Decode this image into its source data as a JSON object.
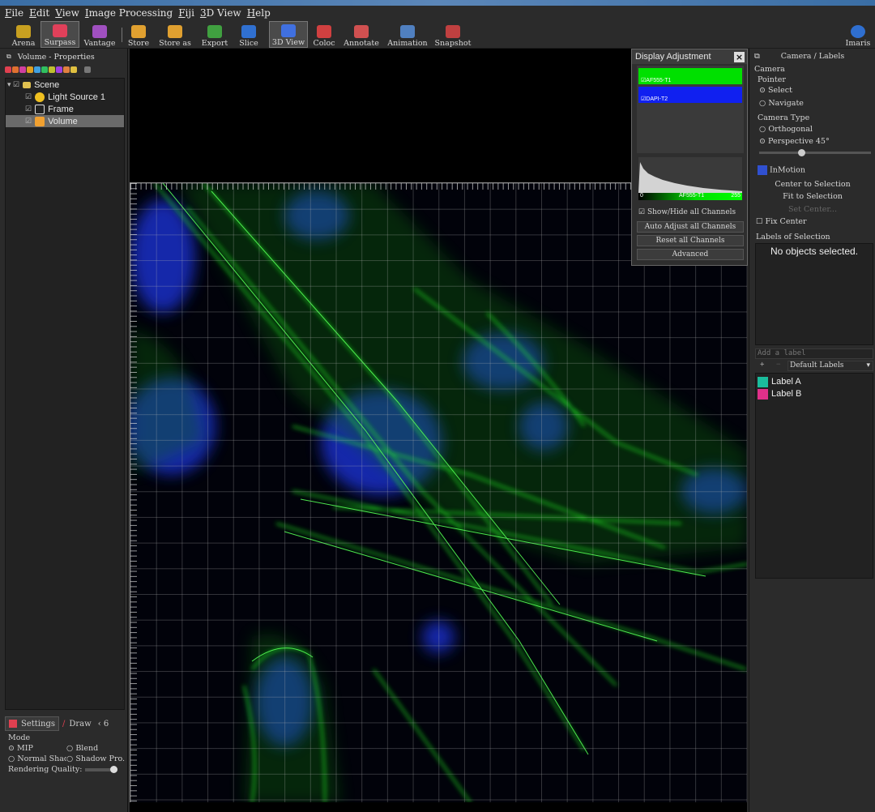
{
  "menu": [
    "File",
    "Edit",
    "View",
    "Image Processing",
    "Fiji",
    "3D View",
    "Help"
  ],
  "toolbar": {
    "buttons": [
      {
        "label": "Arena",
        "icon": "arena-icon",
        "color": "#c8a020"
      },
      {
        "label": "Surpass",
        "icon": "surpass-icon",
        "color": "#e0405a",
        "active": true
      },
      {
        "label": "Vantage",
        "icon": "vantage-icon",
        "color": "#a050c0"
      },
      {
        "label": "Store",
        "icon": "store-icon",
        "color": "#e0a030"
      },
      {
        "label": "Store as",
        "icon": "store-as-icon",
        "color": "#e0a030"
      },
      {
        "label": "Export",
        "icon": "export-icon",
        "color": "#40a040"
      },
      {
        "label": "Slice",
        "icon": "slice-icon",
        "color": "#3070d0"
      },
      {
        "label": "3D View",
        "icon": "3d-view-icon",
        "color": "#4070e0",
        "active": true
      },
      {
        "label": "Coloc",
        "icon": "coloc-icon",
        "color": "#d04040"
      },
      {
        "label": "Annotate",
        "icon": "annotate-icon",
        "color": "#d05050"
      },
      {
        "label": "Animation",
        "icon": "animation-icon",
        "color": "#5080c0"
      },
      {
        "label": "Snapshot",
        "icon": "snapshot-icon",
        "color": "#c04040"
      }
    ],
    "brand": "Imaris"
  },
  "left": {
    "header": "Volume - Properties",
    "tree": [
      {
        "label": "Scene",
        "icon": "folder-icon"
      },
      {
        "label": "Light Source 1",
        "icon": "light-source-icon"
      },
      {
        "label": "Frame",
        "icon": "frame-icon"
      },
      {
        "label": "Volume",
        "icon": "volume-icon",
        "selected": true
      }
    ],
    "tabs": [
      "Settings",
      "Draw"
    ],
    "settings": {
      "mode_label": "Mode",
      "options": [
        "MIP",
        "Blend",
        "Normal Shac",
        "Shadow Pro."
      ],
      "selected": "MIP",
      "quality_label": "Rendering Quality:"
    }
  },
  "display_adjustment": {
    "title": "Display Adjustment",
    "channels": [
      {
        "name": "AF555-T1",
        "color": "#00e000"
      },
      {
        "name": "DAPI-T2",
        "color": "#1020f0"
      }
    ],
    "range_min": "0",
    "range_max": "255",
    "active_channel": "AF555-T1",
    "show_hide": "Show/Hide all Channels",
    "buttons": [
      "Auto Adjust all Channels",
      "Reset all Channels",
      "Advanced"
    ]
  },
  "right": {
    "header": "Camera / Labels",
    "camera": "Camera",
    "pointer": "Pointer",
    "pointer_options": [
      "Select",
      "Navigate"
    ],
    "camera_type": "Camera Type",
    "camera_type_options": [
      "Orthogonal",
      "Perspective 45°"
    ],
    "inmotion": "InMotion",
    "center_selection": "Center to Selection",
    "fit_selection": "Fit to Selection",
    "set_center": "Set Center...",
    "fix_center": "Fix Center",
    "labels_of_selection": "Labels of Selection",
    "no_objects": "No objects selected.",
    "add_label_placeholder": "Add a label",
    "default_labels": "Default Labels",
    "labels": [
      {
        "name": "Label A",
        "color": "#1abc9c"
      },
      {
        "name": "Label B",
        "color": "#e0308a"
      }
    ]
  }
}
